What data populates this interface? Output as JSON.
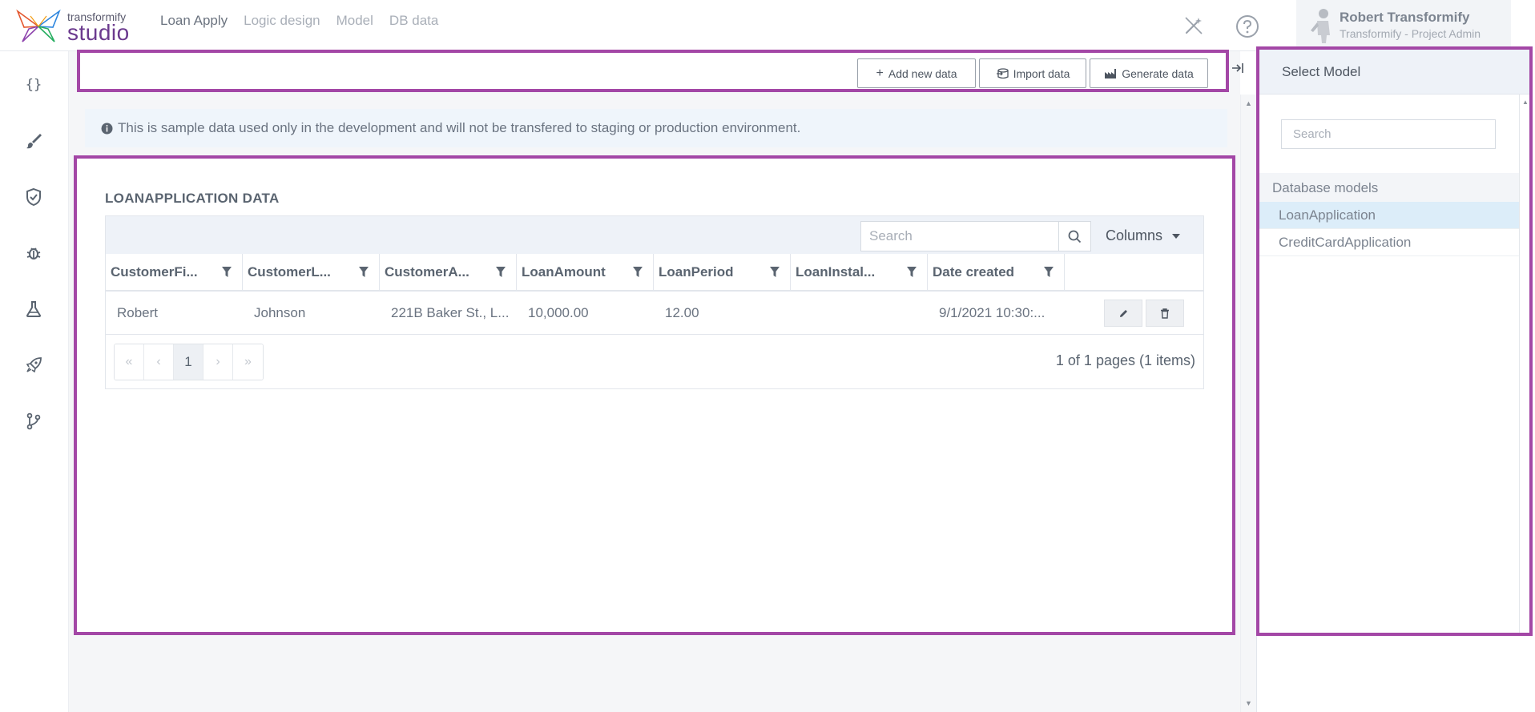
{
  "header": {
    "logo_top": "transformify",
    "logo_bottom": "studio",
    "nav": [
      "Loan Apply",
      "Logic design",
      "Model",
      "DB data"
    ],
    "active_nav": "Loan Apply",
    "user_name": "Robert Transformify",
    "user_role": "Transformify - Project Admin"
  },
  "sidebar": {
    "icons": [
      "braces-icon",
      "brush-icon",
      "shield-check-icon",
      "bug-icon",
      "flask-icon",
      "rocket-icon",
      "branch-icon"
    ],
    "labels": [
      "{}"
    ]
  },
  "toolbar": {
    "add_label": "Add new data",
    "import_label": "Import data",
    "generate_label": "Generate data"
  },
  "info_message": "This is sample data used only in the development and will not be transfered to staging or production environment.",
  "grid": {
    "title": "LOANAPPLICATION DATA",
    "search_placeholder": "Search",
    "columns_label": "Columns",
    "headers": [
      "CustomerFi...",
      "CustomerL...",
      "CustomerA...",
      "LoanAmount",
      "LoanPeriod",
      "LoanInstal...",
      "Date created"
    ],
    "rows": [
      [
        "Robert",
        "Johnson",
        "221B Baker St., L...",
        "10,000.00",
        "12.00",
        "",
        "9/1/2021 10:30:..."
      ]
    ],
    "current_page": "1",
    "pager_info": "1 of 1 pages (1 items)"
  },
  "right_panel": {
    "title": "Select Model",
    "search_placeholder": "Search",
    "section": "Database models",
    "items": [
      "LoanApplication",
      "CreditCardApplication"
    ],
    "selected": "LoanApplication"
  },
  "colors": {
    "accent_border": "#a347a6",
    "brand": "#6b3a8e",
    "selected_item": "#dcedf9"
  }
}
